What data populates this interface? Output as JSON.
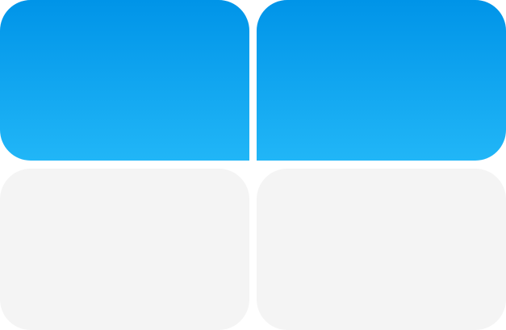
{
  "tiles": [
    {
      "id": "top-left",
      "fill": [
        "#0094E8",
        "#21B6F7"
      ]
    },
    {
      "id": "top-right",
      "fill": [
        "#0094E8",
        "#21B6F7"
      ]
    },
    {
      "id": "bottom-left",
      "fill": [
        "#F4F4F4",
        "#F4F4F4"
      ]
    },
    {
      "id": "bottom-right",
      "fill": [
        "#F4F4F4",
        "#F4F4F4"
      ]
    }
  ]
}
